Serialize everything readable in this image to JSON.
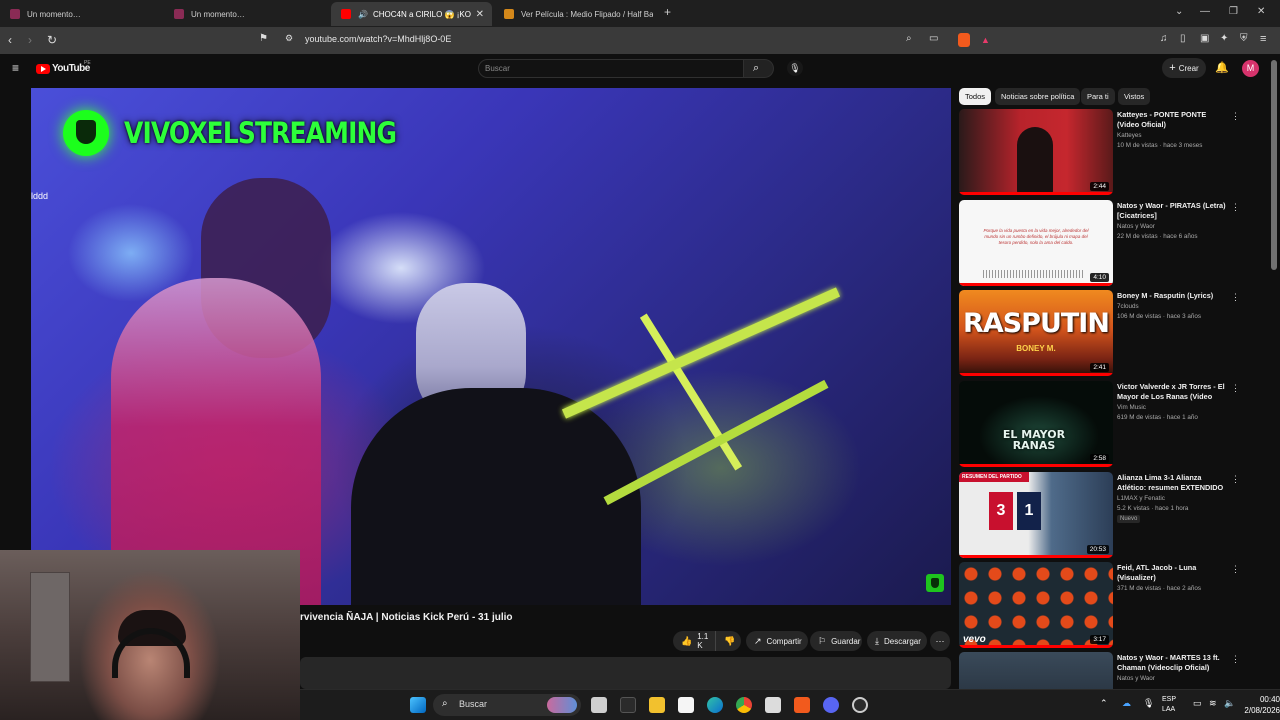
{
  "browser": {
    "tabs": [
      {
        "title": "Un momento…",
        "active": false
      },
      {
        "title": "Un momento…",
        "active": false
      },
      {
        "title": "CHOC4N a CIRILO 😱 ¡KO",
        "active": true
      },
      {
        "title": "Ver Película : Medio Flipado / Half Ba",
        "active": false
      }
    ],
    "new_tab": "+",
    "url": "youtube.com/watch?v=MhdHlj8O-0E"
  },
  "youtube": {
    "logo_text": "YouTube",
    "country_code": "PE",
    "search_placeholder": "Buscar",
    "create_label": "Crear",
    "avatar_letter": "M"
  },
  "player": {
    "streamer_name": "VIVOXELSTREAMING",
    "overlay_text": "lddd"
  },
  "video": {
    "title": "rvivencia ÑAJA | Noticias Kick Perú - 31 julio",
    "likes": "1.1 K",
    "share_label": "Compartir",
    "save_label": "Guardar",
    "download_label": "Descargar"
  },
  "chips": [
    "Todos",
    "Noticias sobre política",
    "Para ti",
    "Vistos"
  ],
  "recommendations": [
    {
      "title": "Katteyes - PONTE PONTE (Video Oficial)",
      "channel": "Katteyes",
      "meta": "10 M de vistas · hace 3 meses",
      "duration": "2:44"
    },
    {
      "title": "Natos y Waor - PIRATAS (Letra) [Cicatrices]",
      "channel": "Natos y Waor",
      "meta": "22 M de vistas · hace 6 años",
      "duration": "4:10",
      "thumb_text": "Porque la vida puesta en la vida mejor, alrededor del mundo sin un rumbo definido, el brújula ni mapa del tesoro perdido, solo la ama del caldo."
    },
    {
      "title": "Boney M - Rasputin (Lyrics)",
      "channel": "7clouds",
      "meta": "106 M de vistas · hace 3 años",
      "duration": "2:41",
      "thumb_title": "RASPUTIN",
      "thumb_sub": "BONEY M."
    },
    {
      "title": "Victor Valverde x JR Torres - El Mayor de Los Ranas (Video Oficial)",
      "channel": "Vim Music",
      "meta": "619 M de vistas · hace 1 año",
      "duration": "2:58",
      "thumb_title": "EL MAYOR RANAS"
    },
    {
      "title": "Alianza Lima 3-1 Alianza Atlético: resumen EXTENDIDO del partido de…",
      "channel": "L1MAX y Fenatic",
      "meta": "5.2 K vistas · hace 1 hora",
      "badge": "Nuevo",
      "duration": "20:53",
      "thumb_banner": "RESUMEN DEL PARTIDO",
      "score_left": "3",
      "score_right": "1"
    },
    {
      "title": "Feid, ATL Jacob - Luna (Visualizer)",
      "channel": "Feid",
      "meta": "371 M de vistas · hace 2 años",
      "duration": "3:17",
      "thumb_brand": "vevo"
    },
    {
      "title": "Natos y Waor - MARTES 13 ft. Chaman (Videoclip Oficial) [Mart…",
      "channel": "Natos y Waor",
      "meta": ""
    }
  ],
  "taskbar": {
    "search_placeholder": "Buscar",
    "lang_1": "ESP",
    "lang_2": "LAA",
    "time": "00:40",
    "date": "2/08/2026"
  }
}
